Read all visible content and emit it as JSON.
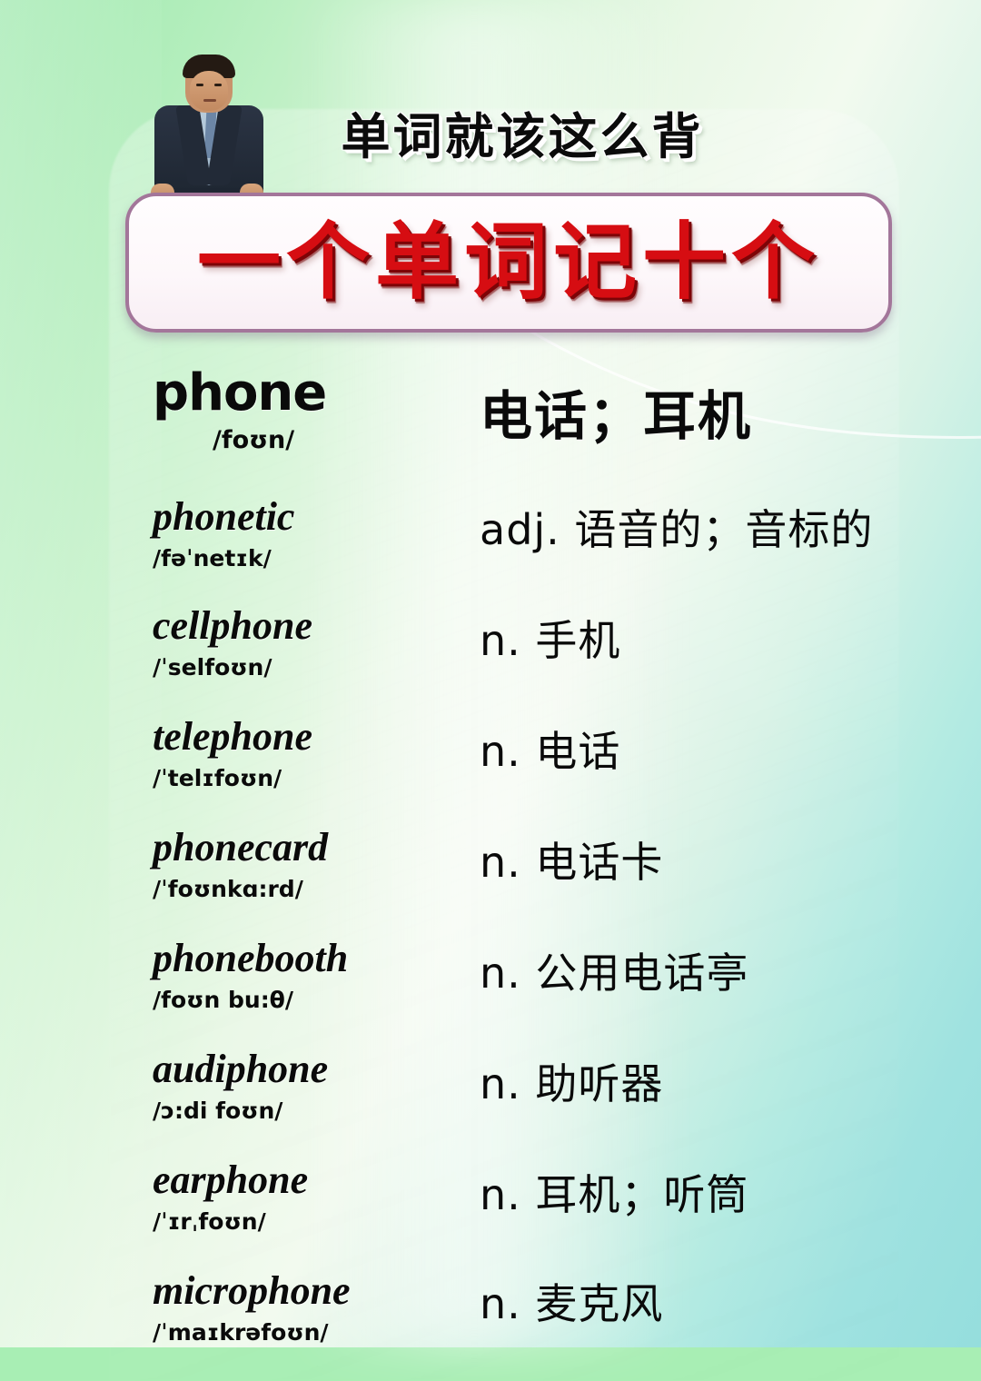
{
  "header": {
    "subtitle": "单词就该这么背",
    "title": "一个单词记十个",
    "avatar_name": "teacher-portrait",
    "title_color": "#d60d12",
    "banner_border_color": "#a3769a"
  },
  "word_list": [
    {
      "word": "phone",
      "ipa": "/foʊn/",
      "meaning": "电话；耳机",
      "is_headword": true
    },
    {
      "word": "phonetic",
      "ipa": "/fəˈnetɪk/",
      "meaning": "adj. 语音的；音标的",
      "is_headword": false
    },
    {
      "word": "cellphone",
      "ipa": "/ˈselfoʊn/",
      "meaning": "n. 手机",
      "is_headword": false
    },
    {
      "word": "telephone",
      "ipa": "/ˈtelɪfoʊn/",
      "meaning": "n. 电话",
      "is_headword": false
    },
    {
      "word": "phonecard",
      "ipa": "/ˈfoʊnkɑ:rd/",
      "meaning": "n. 电话卡",
      "is_headword": false
    },
    {
      "word": "phonebooth",
      "ipa": "/foʊn bu:θ/",
      "meaning": "n. 公用电话亭",
      "is_headword": false
    },
    {
      "word": "audiphone",
      "ipa": "/ɔ:di foʊn/",
      "meaning": "n. 助听器",
      "is_headword": false
    },
    {
      "word": "earphone",
      "ipa": "/ˈɪrˌfoʊn/",
      "meaning": "n. 耳机；听筒",
      "is_headword": false
    },
    {
      "word": "microphone",
      "ipa": "/ˈmaɪkrəfoʊn/",
      "meaning": "n. 麦克风",
      "is_headword": false
    }
  ],
  "background": {
    "gradient_start": "#9fe9ae",
    "gradient_mid": "#f2faef",
    "gradient_end": "#95dedd"
  }
}
